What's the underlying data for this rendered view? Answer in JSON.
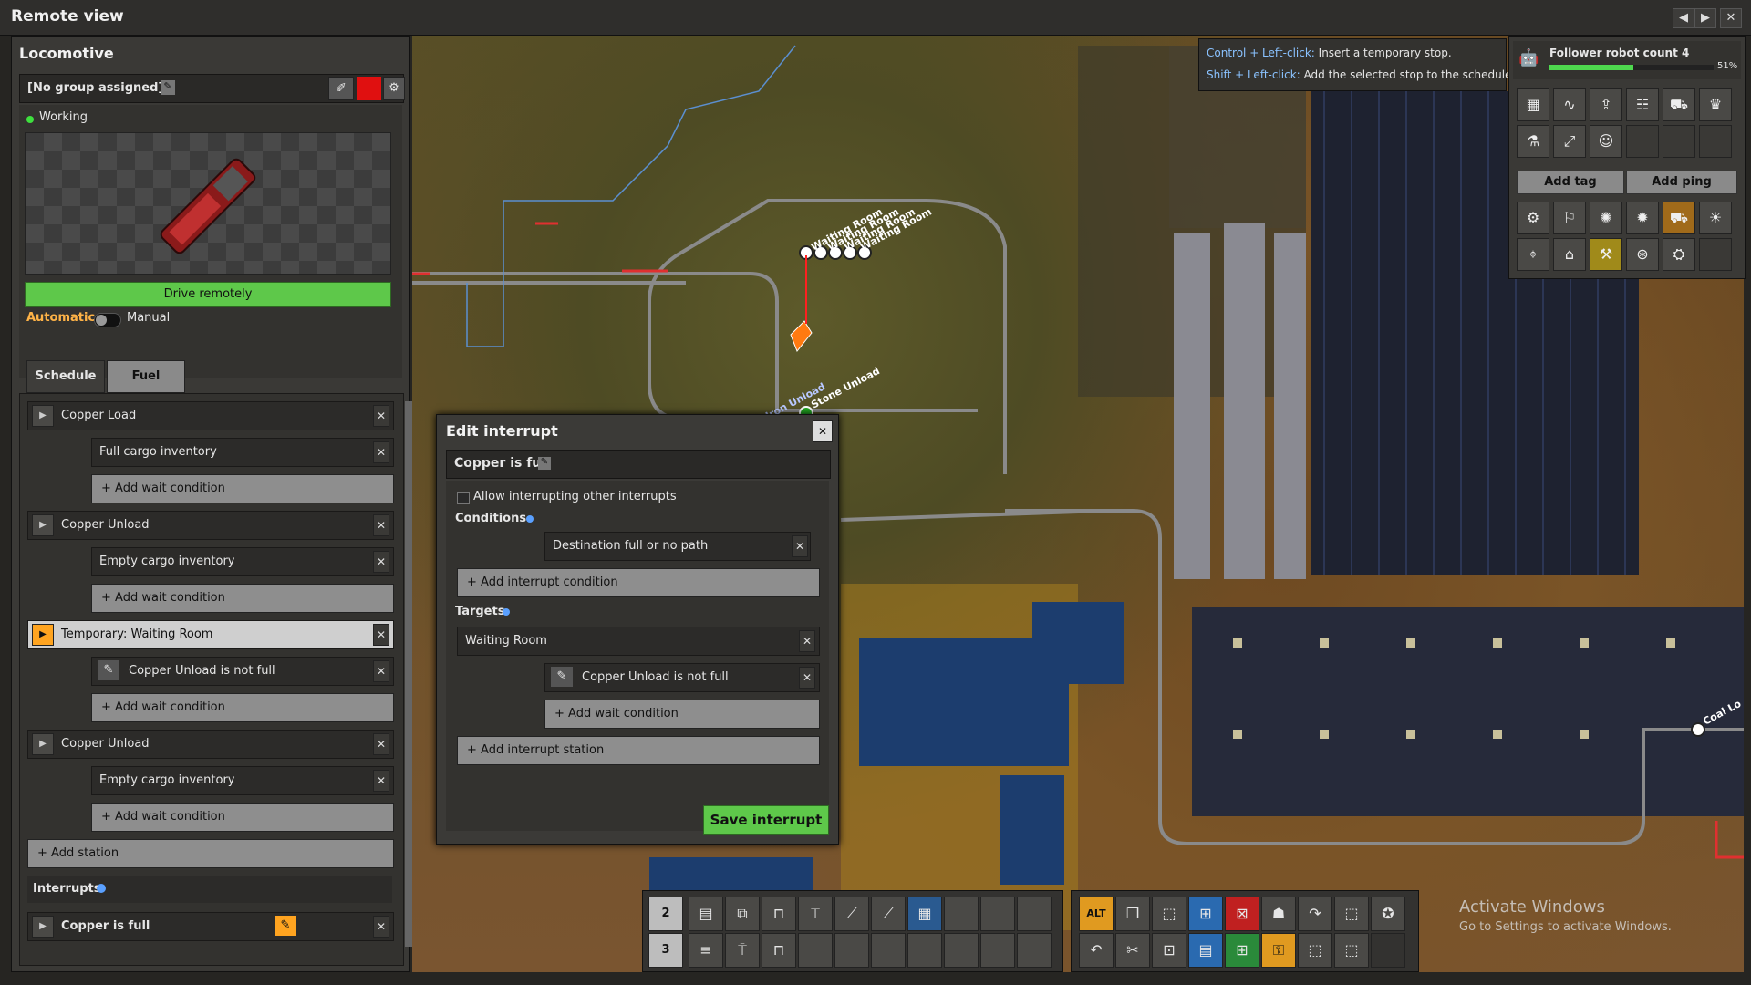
{
  "window": {
    "title": "Remote view"
  },
  "locomotive": {
    "title": "Locomotive",
    "group": "[No group assigned]",
    "status": "Working",
    "drive_remotely": "Drive remotely",
    "mode_automatic": "Automatic",
    "mode_manual": "Manual",
    "color_swatch": "#e01010"
  },
  "tabs": {
    "schedule": "Schedule",
    "fuel": "Fuel"
  },
  "schedule": {
    "stations": [
      {
        "name": "Copper Load",
        "conditions": [
          "Full cargo inventory"
        ],
        "add_wait": "+ Add wait condition"
      },
      {
        "name": "Copper Unload",
        "conditions": [
          "Empty cargo inventory"
        ],
        "add_wait": "+ Add wait condition"
      },
      {
        "name": "Temporary: Waiting Room",
        "conditions": [
          "Copper Unload is not full"
        ],
        "add_wait": "+ Add wait condition"
      },
      {
        "name": "Copper Unload",
        "conditions": [
          "Empty cargo inventory"
        ],
        "add_wait": "+ Add wait condition"
      }
    ],
    "add_station": "+ Add station",
    "interrupts_label": "Interrupts",
    "interrupt_item": "Copper is full"
  },
  "edit_interrupt": {
    "title": "Edit interrupt",
    "name": "Copper is full",
    "allow_interrupting": "Allow interrupting other interrupts",
    "conditions_label": "Conditions",
    "condition": "Destination full or no path",
    "add_interrupt_condition": "+ Add interrupt condition",
    "targets_label": "Targets",
    "target_station": "Waiting Room",
    "target_condition": "Copper Unload is not full",
    "add_wait_condition": "+ Add wait condition",
    "add_interrupt_station": "+ Add interrupt station",
    "save": "Save interrupt"
  },
  "tooltip": {
    "line1_key": "Control + Left-click:",
    "line1_text": "Insert a temporary stop.",
    "line2_key": "Shift + Left-click:",
    "line2_text": "Add the selected stop to the schedule."
  },
  "right_panel": {
    "follower_label": "Follower robot count 4",
    "follower_percent": "51%",
    "follower_fill": 0.51,
    "add_tag": "Add tag",
    "add_ping": "Add ping"
  },
  "map_labels": {
    "waiting_room_1": "Waiting Room",
    "waiting_room_2": "Waiting Room",
    "waiting_room_3": "Waiting Room",
    "waiting_room_4": "Waiting Room",
    "stone_unload": "Stone Unload",
    "iron_unload": "Iron Unload",
    "iron_unload_2": "Unload",
    "coal_lo": "Coal Lo"
  },
  "quickbar": {
    "row1": "2",
    "row2": "3"
  },
  "watermark": {
    "line1": "Activate Windows",
    "line2": "Go to Settings to activate Windows."
  }
}
